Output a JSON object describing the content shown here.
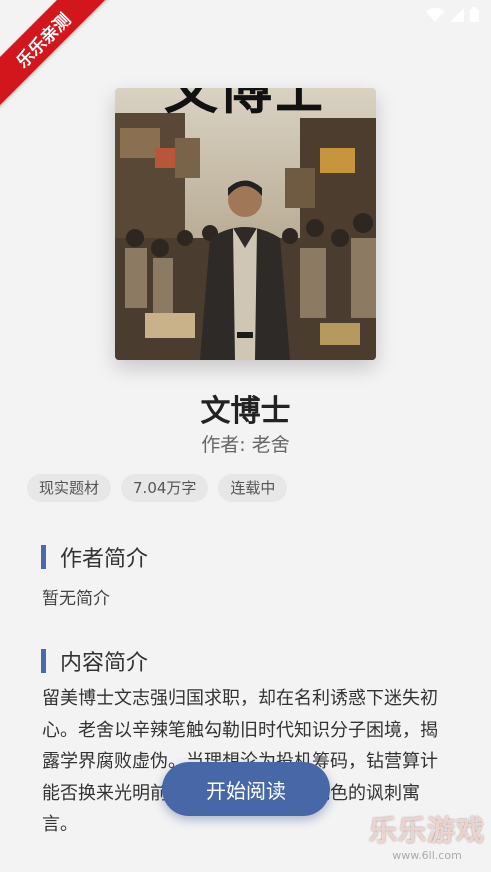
{
  "ribbon": {
    "text": "乐乐亲测"
  },
  "book": {
    "cover_title": "文博士",
    "title": "文博士",
    "author": "作者: 老舍",
    "tags": [
      "现实题材",
      "7.04万字",
      "连载中"
    ]
  },
  "author_section": {
    "heading": "作者简介",
    "text": "暂无简介"
  },
  "content_section": {
    "heading": "内容简介",
    "text": "留美博士文志强归国求职，却在名利诱惑下迷失初心。老舍以辛辣笔触勾勒旧时代知识分子困境，揭露学界腐败虚伪。当理想沦为投机筹码，钻营算计能否换来光明前途？一部拷问人性底色的讽刺寓言。"
  },
  "actions": {
    "start_reading": "开始阅读"
  },
  "watermark": {
    "brand": "乐乐游戏",
    "url": "www.6ll.com"
  },
  "colors": {
    "accent": "#4767a6",
    "ribbon": "#d2161c",
    "section_bar": "#4a6aa8"
  }
}
